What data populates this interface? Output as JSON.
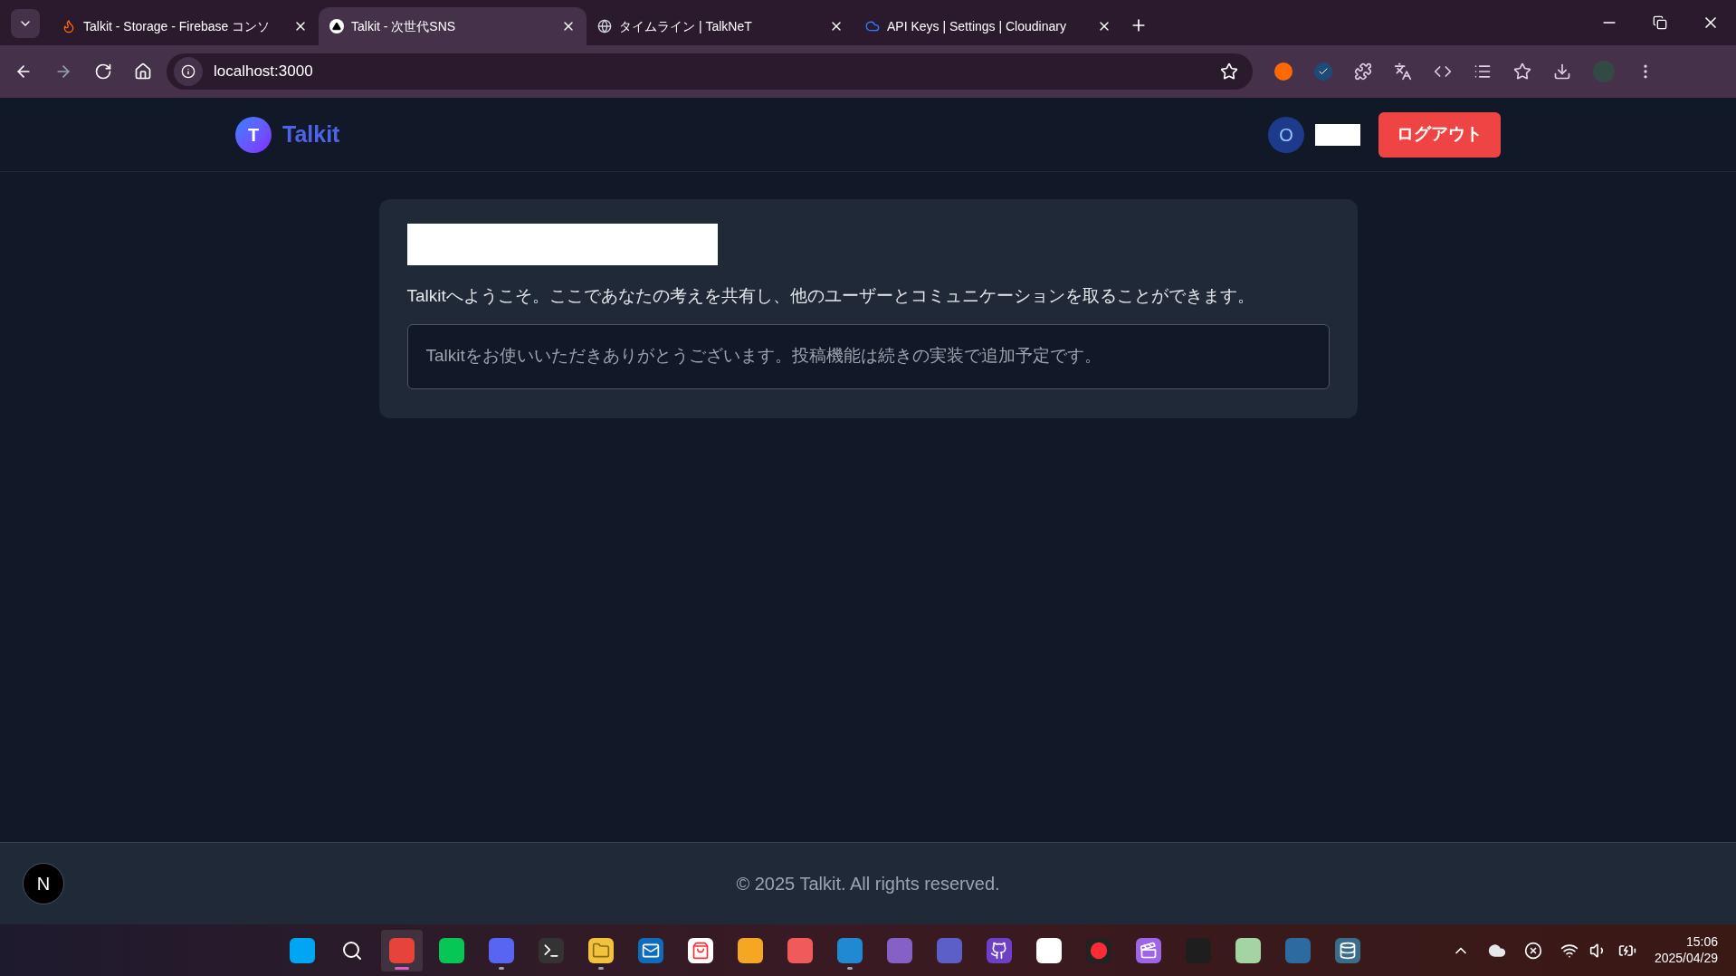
{
  "browser": {
    "tabs": [
      {
        "title": "Talkit - Storage - Firebase コンソ",
        "kind": "flame",
        "selected": false
      },
      {
        "title": "Talkit - 次世代SNS",
        "kind": "triangle",
        "selected": true
      },
      {
        "title": "タイムライン | TalkNeT",
        "kind": "globe",
        "selected": false
      },
      {
        "title": "API Keys | Settings | Cloudinary",
        "kind": "cloud",
        "selected": false
      }
    ],
    "url": "localhost:3000"
  },
  "header": {
    "logo_letter": "T",
    "brand": "Talkit",
    "avatar_letter": "O",
    "logout": "ログアウト"
  },
  "card": {
    "intro": "Talkitへようこそ。ここであなたの考えを共有し、他のユーザーとコミュニケーションを取ることができます。",
    "notice": "Talkitをお使いいただきありがとうございます。投稿機能は続きの実装で追加予定です。"
  },
  "footer": {
    "dev_badge": "N",
    "copyright": "© 2025 Talkit. All rights reserved."
  },
  "taskbar": {
    "apps": [
      {
        "kind": "start",
        "running": false,
        "active": false
      },
      {
        "kind": "search",
        "running": false,
        "active": false
      },
      {
        "kind": "chrome",
        "running": true,
        "active": true
      },
      {
        "kind": "line",
        "running": false,
        "active": false
      },
      {
        "kind": "discord",
        "running": true,
        "active": false
      },
      {
        "kind": "terminal",
        "running": false,
        "active": false
      },
      {
        "kind": "folder",
        "running": true,
        "active": false
      },
      {
        "kind": "outlook",
        "running": false,
        "active": false
      },
      {
        "kind": "store",
        "running": false,
        "active": false
      },
      {
        "kind": "sublime",
        "running": false,
        "active": false
      },
      {
        "kind": "typora",
        "running": false,
        "active": false
      },
      {
        "kind": "vscode",
        "running": true,
        "active": false
      },
      {
        "kind": "vstudio",
        "running": false,
        "active": false
      },
      {
        "kind": "teams",
        "running": false,
        "active": false
      },
      {
        "kind": "github",
        "running": false,
        "active": false
      },
      {
        "kind": "appstore",
        "running": false,
        "active": false
      },
      {
        "kind": "recorder",
        "running": false,
        "active": false
      },
      {
        "kind": "clapper",
        "running": false,
        "active": false
      },
      {
        "kind": "figma",
        "running": false,
        "active": false
      },
      {
        "kind": "vim",
        "running": false,
        "active": false
      },
      {
        "kind": "markdown",
        "running": false,
        "active": false
      },
      {
        "kind": "database",
        "running": false,
        "active": false
      }
    ],
    "time": "15:06",
    "date": "2025/04/29"
  }
}
